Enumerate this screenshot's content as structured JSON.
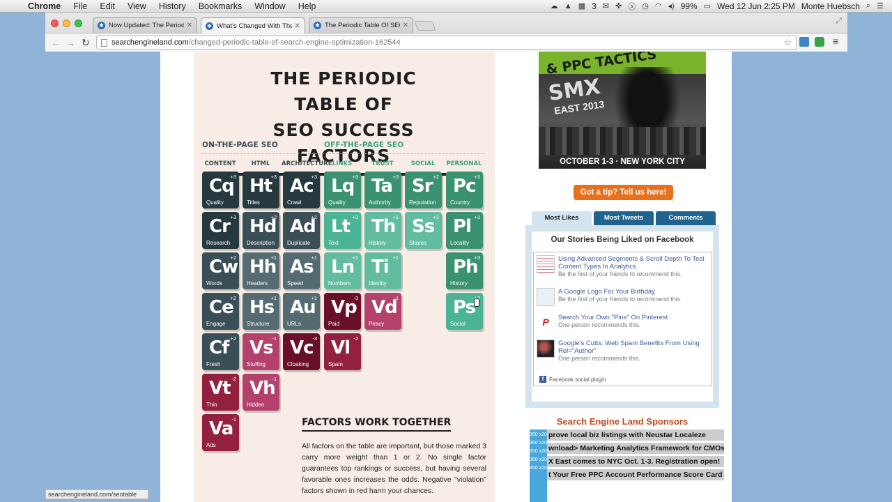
{
  "menubar": {
    "app": "Chrome",
    "menus": [
      "File",
      "Edit",
      "View",
      "History",
      "Bookmarks",
      "Window",
      "Help"
    ],
    "battery": "99%",
    "clock": "Wed 12 Jun  2:25 PM",
    "user": "Monte Huebsch",
    "calendar_count": "3"
  },
  "tabs": [
    {
      "title": "Now Updated: The Periodic"
    },
    {
      "title": "What's Changed With The"
    },
    {
      "title": "The Periodic Table Of SEO"
    }
  ],
  "address": {
    "host": "searchengineland.com",
    "path": "/changed-periodic-table-of-search-engine-optimization-162544"
  },
  "infographic": {
    "title_line1": "THE PERIODIC TABLE OF",
    "title_line2": "SEO SUCCESS FACTORS",
    "on_page": "ON-THE-PAGE SEO",
    "off_page": "OFF-THE-PAGE SEO",
    "columns": [
      "CONTENT",
      "HTML",
      "ARCHITECTURE",
      "LINKS",
      "TRUST",
      "SOCIAL",
      "PERSONAL"
    ],
    "elements": [
      {
        "sym": "Cq",
        "name": "Quality",
        "wt": "+3",
        "cls": "c-content"
      },
      {
        "sym": "Ht",
        "name": "Titles",
        "wt": "+3",
        "cls": "c-content"
      },
      {
        "sym": "Ac",
        "name": "Crawl",
        "wt": "+3",
        "cls": "c-content"
      },
      {
        "sym": "Lq",
        "name": "Quality",
        "wt": "+3",
        "cls": "c-pers"
      },
      {
        "sym": "Ta",
        "name": "Authority",
        "wt": "+3",
        "cls": "c-pers"
      },
      {
        "sym": "Sr",
        "name": "Reputation",
        "wt": "+2",
        "cls": "c-pers"
      },
      {
        "sym": "Pc",
        "name": "Country",
        "wt": "+3",
        "cls": "c-pers"
      },
      {
        "sym": "Cr",
        "name": "Research",
        "wt": "+3",
        "cls": "c-content"
      },
      {
        "sym": "Hd",
        "name": "Description",
        "wt": "+2",
        "cls": "c-html"
      },
      {
        "sym": "Ad",
        "name": "Duplicate",
        "wt": "+2",
        "cls": "c-html"
      },
      {
        "sym": "Lt",
        "name": "Text",
        "wt": "+2",
        "cls": "c-links"
      },
      {
        "sym": "Th",
        "name": "History",
        "wt": "+1",
        "cls": "c-trust"
      },
      {
        "sym": "Ss",
        "name": "Shares",
        "wt": "+1",
        "cls": "c-trust"
      },
      {
        "sym": "Pl",
        "name": "Locality",
        "wt": "+3",
        "cls": "c-pers"
      },
      {
        "sym": "Cw",
        "name": "Words",
        "wt": "+2",
        "cls": "c-html"
      },
      {
        "sym": "Hh",
        "name": "Headers",
        "wt": "+1",
        "cls": "c-arch"
      },
      {
        "sym": "As",
        "name": "Speed",
        "wt": "+1",
        "cls": "c-arch"
      },
      {
        "sym": "Ln",
        "name": "Numbers",
        "wt": "+1",
        "cls": "c-trust"
      },
      {
        "sym": "Ti",
        "name": "Identity",
        "wt": "+1",
        "cls": "c-trust"
      },
      {
        "sym": "Ph",
        "name": "History",
        "wt": "+3",
        "cls": "c-pers"
      },
      {
        "sym": "Ce",
        "name": "Engage",
        "wt": "+2",
        "cls": "c-html"
      },
      {
        "sym": "Hs",
        "name": "Structure",
        "wt": "+1",
        "cls": "c-arch"
      },
      {
        "sym": "Au",
        "name": "URLs",
        "wt": "+1",
        "cls": "c-arch"
      },
      {
        "sym": "Vp",
        "name": "Paid",
        "wt": "-3",
        "cls": "c-neg2"
      },
      {
        "sym": "Vd",
        "name": "Piracy",
        "wt": "-1",
        "cls": "c-neg3"
      },
      {
        "sym": "Ps",
        "name": "Social",
        "wt": "+2",
        "cls": "c-links"
      },
      {
        "sym": "Cf",
        "name": "Fresh",
        "wt": "+2",
        "cls": "c-html"
      },
      {
        "sym": "Vs",
        "name": "Stuffing",
        "wt": "-1",
        "cls": "c-neg3"
      },
      {
        "sym": "Vc",
        "name": "Cloaking",
        "wt": "-3",
        "cls": "c-neg2"
      },
      {
        "sym": "Vl",
        "name": "Spam",
        "wt": "-2",
        "cls": "c-neg1"
      },
      {
        "sym": "Vt",
        "name": "Thin",
        "wt": "-2",
        "cls": "c-neg1"
      },
      {
        "sym": "Vh",
        "name": "Hidden",
        "wt": "-1",
        "cls": "c-neg3"
      },
      {
        "sym": "Va",
        "name": "Ads",
        "wt": "-1",
        "cls": "c-neg1"
      }
    ],
    "factors_heading": "FACTORS WORK TOGETHER",
    "factors_body": "All factors on the table are important, but those marked 3 carry more weight than 1 or 2. No single factor guarantees top rankings or success, but having several favorable ones increases the odds. Negative \"violation\" factors shown in red harm your chances."
  },
  "sidebar": {
    "ad_headline": "& PPC TACTICS",
    "ad_smx": "SMX",
    "ad_east": "EAST 2013",
    "ad_dates": "OCTOBER 1-3 · NEW YORK CITY",
    "tip_button": "Got a tip? Tell us here!",
    "tabs": [
      "Most Likes",
      "Most Tweets",
      "Comments"
    ],
    "fb_title": "Our Stories Being Liked on Facebook",
    "fb_items": [
      {
        "title": "Using Advanced Segments & Scroll Depth To Test Content Types In Analytics",
        "sub": "Be the first of your friends to recommend this."
      },
      {
        "title": "A Google Logo For Your Birthday",
        "sub": "Be the first of your friends to recommend this."
      },
      {
        "title": "Search Your Own \"Pins\" On Pinterest",
        "sub": "One person recommends this."
      },
      {
        "title": "Google's Cutts: Web Spam Benefits From Using Rel=\"Author\"",
        "sub": "One person recommends this."
      }
    ],
    "fb_footer": "Facebook social plugin",
    "sponsors_title": "Search Engine Land Sponsors",
    "sponsors": [
      "prove local biz listings with Neustar Localeze",
      "wnload> Marketing Analytics Framework for CMOs",
      "X East comes to NYC Oct. 1-3. Registration open!",
      "t Your Free PPC Account Performance Score Card"
    ],
    "tower_label": "350 x20"
  },
  "status_url": "searchengineland.com/seotable"
}
